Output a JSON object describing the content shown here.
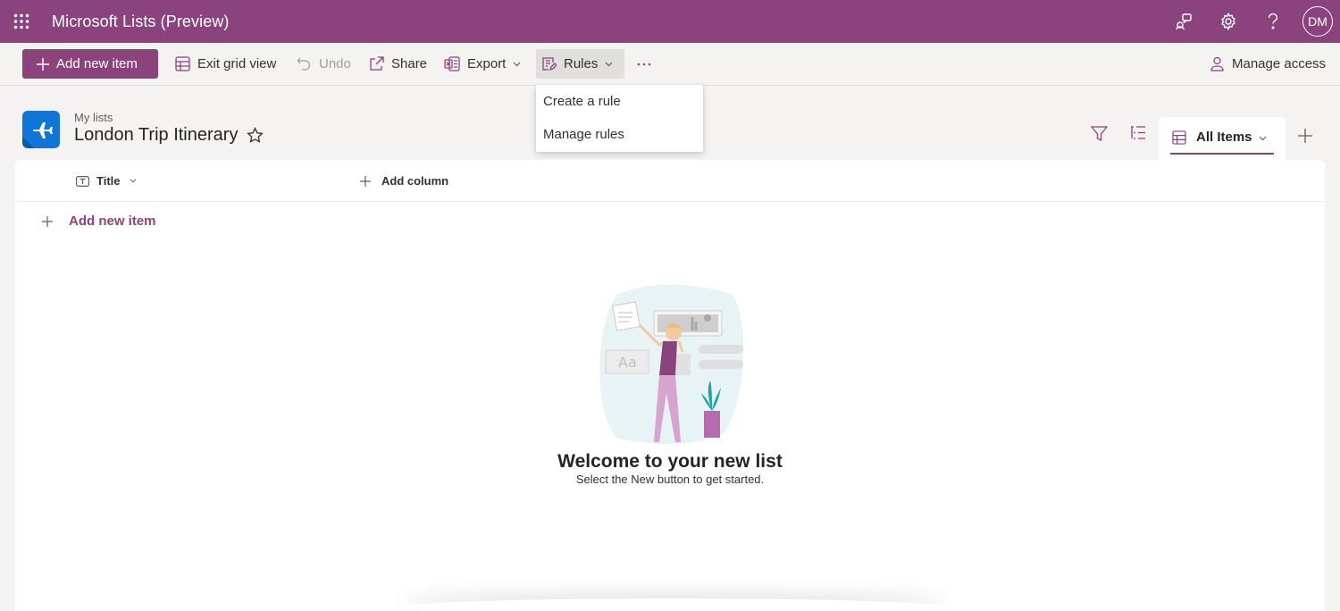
{
  "suitebar": {
    "app_title": "Microsoft Lists (Preview)",
    "avatar_initials": "DM",
    "color": "#8a437d"
  },
  "commandbar": {
    "add_new_item": "Add new item",
    "exit_grid_view": "Exit grid view",
    "undo": "Undo",
    "share": "Share",
    "export": "Export",
    "rules": "Rules",
    "manage_access": "Manage access"
  },
  "rules_menu": {
    "items": [
      "Create a rule",
      "Manage rules"
    ]
  },
  "list": {
    "breadcrumb": "My lists",
    "title": "London Trip Itinerary",
    "view_name": "All Items"
  },
  "grid": {
    "columns": [
      "Title"
    ],
    "add_column": "Add column",
    "add_new_item": "Add new item"
  },
  "empty_state": {
    "title": "Welcome to your new list",
    "subtitle": "Select the New button to get started.",
    "illustration_text": "Aa"
  }
}
